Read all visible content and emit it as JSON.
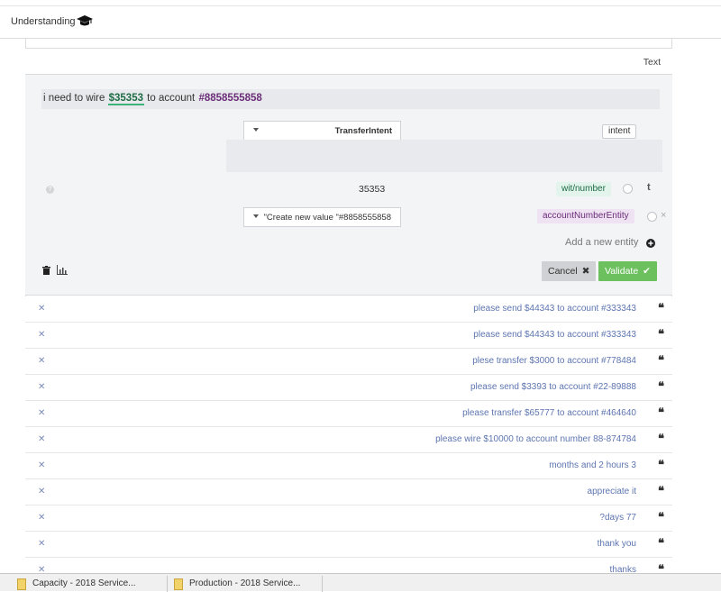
{
  "header": {
    "title": "Understanding",
    "icon": "graduation-cap-icon"
  },
  "text_header": {
    "label": "Text"
  },
  "editor": {
    "sentence": {
      "prefix": "i need to wire ",
      "number": "$35353",
      "middle": " to account ",
      "account": "#8858555858"
    },
    "intent_dropdown": "TransferIntent",
    "intent_tag": "intent",
    "entity_value": "35353",
    "entity_tag_number": "wit/number",
    "entity_dropdown": "\"Create new value \"#8858555858",
    "entity_tag_account": "accountNumberEntity",
    "add_entity": "Add a new entity",
    "cancel_label": "Cancel",
    "validate_label": "Validate"
  },
  "rows": [
    {
      "text": "please send $44343 to account #333343"
    },
    {
      "text": "please send $44343 to account #333343"
    },
    {
      "text": "plese transfer $3000 to account #778484"
    },
    {
      "text": "please send $3393 to account #22-89888"
    },
    {
      "text": "please transfer $65777 to account #464640"
    },
    {
      "text": "please wire $10000 to account number 88-874784"
    },
    {
      "text": "months and 2 hours 3"
    },
    {
      "text": "appreciate it"
    },
    {
      "text": "?days 77"
    },
    {
      "text": "thank you"
    },
    {
      "text": "thanks"
    }
  ],
  "downloads": [
    {
      "label": "Capacity - 2018 Service...",
      "icon": "file-icon"
    },
    {
      "label": "Production - 2018 Service...",
      "icon": "file-icon"
    }
  ],
  "colors": {
    "validate": "#6cc05e",
    "number_tag": "#e3f4ec",
    "account_tag": "#efe3f3",
    "link": "#5d75b0"
  }
}
